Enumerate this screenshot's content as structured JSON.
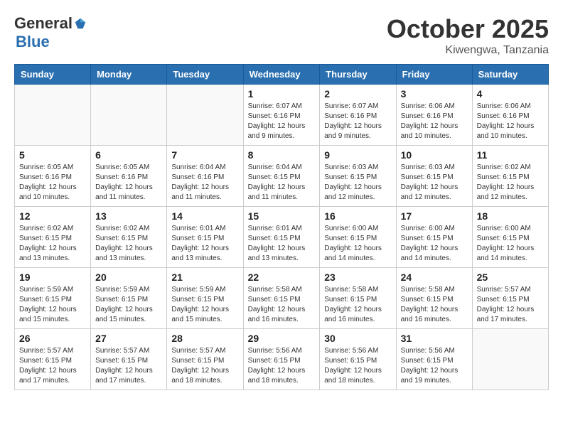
{
  "header": {
    "logo_general": "General",
    "logo_blue": "Blue",
    "month": "October 2025",
    "location": "Kiwengwa, Tanzania"
  },
  "weekdays": [
    "Sunday",
    "Monday",
    "Tuesday",
    "Wednesday",
    "Thursday",
    "Friday",
    "Saturday"
  ],
  "weeks": [
    [
      {
        "day": "",
        "info": ""
      },
      {
        "day": "",
        "info": ""
      },
      {
        "day": "",
        "info": ""
      },
      {
        "day": "1",
        "info": "Sunrise: 6:07 AM\nSunset: 6:16 PM\nDaylight: 12 hours\nand 9 minutes."
      },
      {
        "day": "2",
        "info": "Sunrise: 6:07 AM\nSunset: 6:16 PM\nDaylight: 12 hours\nand 9 minutes."
      },
      {
        "day": "3",
        "info": "Sunrise: 6:06 AM\nSunset: 6:16 PM\nDaylight: 12 hours\nand 10 minutes."
      },
      {
        "day": "4",
        "info": "Sunrise: 6:06 AM\nSunset: 6:16 PM\nDaylight: 12 hours\nand 10 minutes."
      }
    ],
    [
      {
        "day": "5",
        "info": "Sunrise: 6:05 AM\nSunset: 6:16 PM\nDaylight: 12 hours\nand 10 minutes."
      },
      {
        "day": "6",
        "info": "Sunrise: 6:05 AM\nSunset: 6:16 PM\nDaylight: 12 hours\nand 11 minutes."
      },
      {
        "day": "7",
        "info": "Sunrise: 6:04 AM\nSunset: 6:16 PM\nDaylight: 12 hours\nand 11 minutes."
      },
      {
        "day": "8",
        "info": "Sunrise: 6:04 AM\nSunset: 6:15 PM\nDaylight: 12 hours\nand 11 minutes."
      },
      {
        "day": "9",
        "info": "Sunrise: 6:03 AM\nSunset: 6:15 PM\nDaylight: 12 hours\nand 12 minutes."
      },
      {
        "day": "10",
        "info": "Sunrise: 6:03 AM\nSunset: 6:15 PM\nDaylight: 12 hours\nand 12 minutes."
      },
      {
        "day": "11",
        "info": "Sunrise: 6:02 AM\nSunset: 6:15 PM\nDaylight: 12 hours\nand 12 minutes."
      }
    ],
    [
      {
        "day": "12",
        "info": "Sunrise: 6:02 AM\nSunset: 6:15 PM\nDaylight: 12 hours\nand 13 minutes."
      },
      {
        "day": "13",
        "info": "Sunrise: 6:02 AM\nSunset: 6:15 PM\nDaylight: 12 hours\nand 13 minutes."
      },
      {
        "day": "14",
        "info": "Sunrise: 6:01 AM\nSunset: 6:15 PM\nDaylight: 12 hours\nand 13 minutes."
      },
      {
        "day": "15",
        "info": "Sunrise: 6:01 AM\nSunset: 6:15 PM\nDaylight: 12 hours\nand 13 minutes."
      },
      {
        "day": "16",
        "info": "Sunrise: 6:00 AM\nSunset: 6:15 PM\nDaylight: 12 hours\nand 14 minutes."
      },
      {
        "day": "17",
        "info": "Sunrise: 6:00 AM\nSunset: 6:15 PM\nDaylight: 12 hours\nand 14 minutes."
      },
      {
        "day": "18",
        "info": "Sunrise: 6:00 AM\nSunset: 6:15 PM\nDaylight: 12 hours\nand 14 minutes."
      }
    ],
    [
      {
        "day": "19",
        "info": "Sunrise: 5:59 AM\nSunset: 6:15 PM\nDaylight: 12 hours\nand 15 minutes."
      },
      {
        "day": "20",
        "info": "Sunrise: 5:59 AM\nSunset: 6:15 PM\nDaylight: 12 hours\nand 15 minutes."
      },
      {
        "day": "21",
        "info": "Sunrise: 5:59 AM\nSunset: 6:15 PM\nDaylight: 12 hours\nand 15 minutes."
      },
      {
        "day": "22",
        "info": "Sunrise: 5:58 AM\nSunset: 6:15 PM\nDaylight: 12 hours\nand 16 minutes."
      },
      {
        "day": "23",
        "info": "Sunrise: 5:58 AM\nSunset: 6:15 PM\nDaylight: 12 hours\nand 16 minutes."
      },
      {
        "day": "24",
        "info": "Sunrise: 5:58 AM\nSunset: 6:15 PM\nDaylight: 12 hours\nand 16 minutes."
      },
      {
        "day": "25",
        "info": "Sunrise: 5:57 AM\nSunset: 6:15 PM\nDaylight: 12 hours\nand 17 minutes."
      }
    ],
    [
      {
        "day": "26",
        "info": "Sunrise: 5:57 AM\nSunset: 6:15 PM\nDaylight: 12 hours\nand 17 minutes."
      },
      {
        "day": "27",
        "info": "Sunrise: 5:57 AM\nSunset: 6:15 PM\nDaylight: 12 hours\nand 17 minutes."
      },
      {
        "day": "28",
        "info": "Sunrise: 5:57 AM\nSunset: 6:15 PM\nDaylight: 12 hours\nand 18 minutes."
      },
      {
        "day": "29",
        "info": "Sunrise: 5:56 AM\nSunset: 6:15 PM\nDaylight: 12 hours\nand 18 minutes."
      },
      {
        "day": "30",
        "info": "Sunrise: 5:56 AM\nSunset: 6:15 PM\nDaylight: 12 hours\nand 18 minutes."
      },
      {
        "day": "31",
        "info": "Sunrise: 5:56 AM\nSunset: 6:15 PM\nDaylight: 12 hours\nand 19 minutes."
      },
      {
        "day": "",
        "info": ""
      }
    ]
  ]
}
